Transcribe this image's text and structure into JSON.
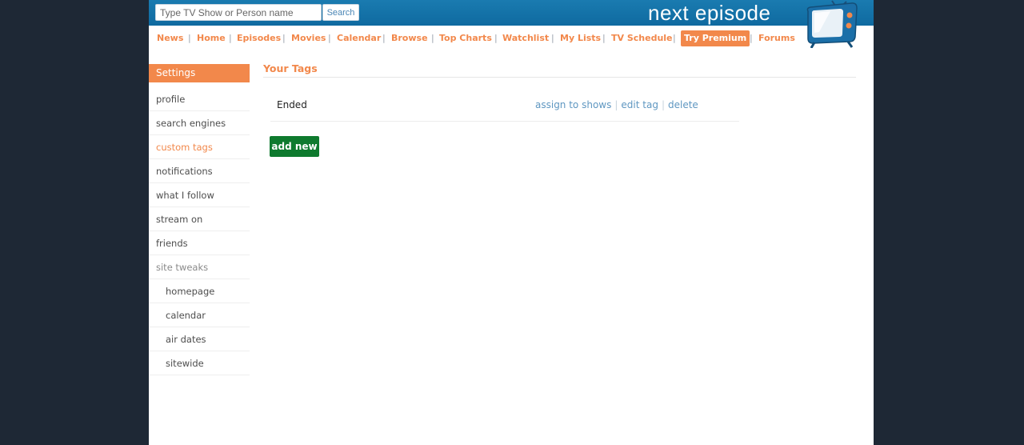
{
  "header": {
    "search_placeholder": "Type TV Show or Person name",
    "search_value": "",
    "search_button": "Search",
    "logo_text": "next episode",
    "logo_icon": "tv-icon"
  },
  "nav": {
    "items": [
      "News",
      "Home",
      "Episodes",
      "Movies",
      "Calendar",
      "Browse",
      "Top Charts",
      "Watchlist",
      "My Lists",
      "TV Schedule",
      "Try Premium",
      "Forums"
    ],
    "separator": "|"
  },
  "sidebar": {
    "title": "Settings",
    "items": [
      "profile",
      "search engines",
      "custom tags",
      "notifications",
      "what I follow",
      "stream on",
      "friends",
      "site tweaks",
      "homepage",
      "calendar",
      "air dates",
      "sitewide"
    ],
    "active": "custom tags"
  },
  "main": {
    "title": "Your Tags",
    "tags": [
      {
        "name": "Ended",
        "actions": [
          "assign to shows",
          "edit tag",
          "delete"
        ]
      }
    ],
    "add_button": "add new"
  },
  "colors": {
    "accent": "#f2884b",
    "header_blue": "#0f6aa0",
    "link_blue": "#5f97c1",
    "button_green": "#0e7a2e",
    "page_background": "#1e2835"
  }
}
